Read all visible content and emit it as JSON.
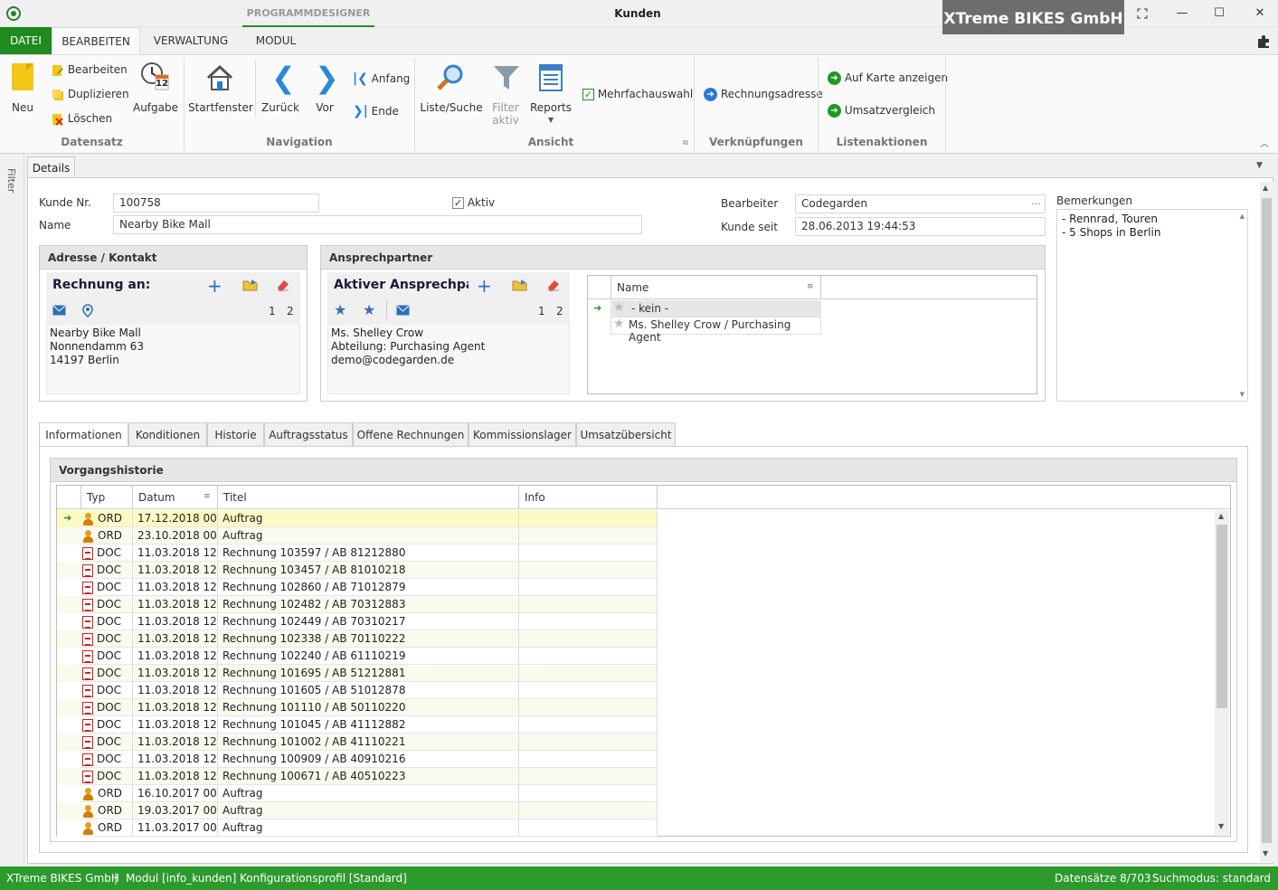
{
  "titlebar": {
    "context_title": "PROGRAMMDESIGNER",
    "window_title": "Kunden",
    "brand": "XTreme BIKES GmbH",
    "controls": {
      "restore_icon": "restore-icon",
      "minimize": "—",
      "maximize": "☐",
      "close": "✕"
    }
  },
  "menu": {
    "tabs": [
      {
        "label": "DATEI"
      },
      {
        "label": "BEARBEITEN"
      },
      {
        "label": "VERWALTUNG"
      },
      {
        "label": "MODUL"
      }
    ]
  },
  "ribbon": {
    "datensatz": {
      "label": "Datensatz",
      "new": "Neu",
      "edit": "Bearbeiten",
      "duplicate": "Duplizieren",
      "delete": "Löschen",
      "task": "Aufgabe",
      "task_badge": "12"
    },
    "navigation": {
      "label": "Navigation",
      "home": "Startfenster",
      "back": "Zurück",
      "forward": "Vor",
      "first": "Anfang",
      "last": "Ende"
    },
    "ansicht": {
      "label": "Ansicht",
      "search": "Liste/Suche",
      "filter": "Filter aktiv",
      "reports": "Reports",
      "multi": "Mehrfachauswahl"
    },
    "verknuepfungen": {
      "label": "Verknüpfungen",
      "invoice_address": "Rechnungsadresse"
    },
    "listenaktionen": {
      "label": "Listenaktionen",
      "map": "Auf Karte anzeigen",
      "compare": "Umsatzvergleich"
    }
  },
  "sidebar": {
    "filter": "Filter"
  },
  "detail_tab": "Details",
  "form": {
    "customer_no_label": "Kunde Nr.",
    "customer_no": "100758",
    "name_label": "Name",
    "name": "Nearby Bike Mall",
    "active_label": "Aktiv",
    "editor_label": "Bearbeiter",
    "editor": "Codegarden",
    "editor_btn": "...",
    "since_label": "Kunde seit",
    "since": "28.06.2013 19:44:53",
    "remarks_label": "Bemerkungen",
    "remarks": [
      "- Rennrad, Touren",
      "- 5 Shops in Berlin"
    ]
  },
  "address": {
    "header": "Adresse / Kontakt",
    "card_title": "Rechnung an:",
    "pages": [
      "1",
      "2"
    ],
    "lines": [
      "Nearby Bike Mall",
      "Nonnendamm 63",
      "14197 Berlin"
    ]
  },
  "contact": {
    "header": "Ansprechpartner",
    "card_title": "Aktiver Ansprechpart",
    "pages": [
      "1",
      "2"
    ],
    "lines": [
      "Ms. Shelley Crow",
      "Abteilung: Purchasing Agent",
      "demo@codegarden.de"
    ],
    "grid_header": "Name",
    "rows": [
      "- kein -",
      "Ms. Shelley Crow / Purchasing Agent"
    ]
  },
  "subtabs": [
    "Informationen",
    "Konditionen",
    "Historie",
    "Auftragsstatus",
    "Offene Rechnungen",
    "Kommissionslager",
    "Umsatzübersicht"
  ],
  "history": {
    "header": "Vorgangshistorie",
    "columns": [
      "Typ",
      "Datum",
      "Titel",
      "Info"
    ],
    "rows": [
      {
        "typ": "ORD",
        "datum": "17.12.2018 00:...",
        "titel": "Auftrag"
      },
      {
        "typ": "ORD",
        "datum": "23.10.2018 00:...",
        "titel": "Auftrag"
      },
      {
        "typ": "DOC",
        "datum": "11.03.2018 12:...",
        "titel": "Rechnung 103597 / AB 81212880"
      },
      {
        "typ": "DOC",
        "datum": "11.03.2018 12:...",
        "titel": "Rechnung 103457 / AB 81010218"
      },
      {
        "typ": "DOC",
        "datum": "11.03.2018 12:...",
        "titel": "Rechnung 102860 / AB 71012879"
      },
      {
        "typ": "DOC",
        "datum": "11.03.2018 12:...",
        "titel": "Rechnung 102482 / AB 70312883"
      },
      {
        "typ": "DOC",
        "datum": "11.03.2018 12:...",
        "titel": "Rechnung 102449 / AB 70310217"
      },
      {
        "typ": "DOC",
        "datum": "11.03.2018 12:...",
        "titel": "Rechnung 102338 / AB 70110222"
      },
      {
        "typ": "DOC",
        "datum": "11.03.2018 12:...",
        "titel": "Rechnung 102240 / AB 61110219"
      },
      {
        "typ": "DOC",
        "datum": "11.03.2018 12:...",
        "titel": "Rechnung 101695 / AB 51212881"
      },
      {
        "typ": "DOC",
        "datum": "11.03.2018 12:...",
        "titel": "Rechnung 101605 / AB 51012878"
      },
      {
        "typ": "DOC",
        "datum": "11.03.2018 12:...",
        "titel": "Rechnung 101110 / AB 50110220"
      },
      {
        "typ": "DOC",
        "datum": "11.03.2018 12:...",
        "titel": "Rechnung 101045 / AB 41112882"
      },
      {
        "typ": "DOC",
        "datum": "11.03.2018 12:...",
        "titel": "Rechnung 101002 / AB 41110221"
      },
      {
        "typ": "DOC",
        "datum": "11.03.2018 12:...",
        "titel": "Rechnung 100909 / AB 40910216"
      },
      {
        "typ": "DOC",
        "datum": "11.03.2018 12:...",
        "titel": "Rechnung 100671 / AB 40510223"
      },
      {
        "typ": "ORD",
        "datum": "16.10.2017 00:...",
        "titel": "Auftrag"
      },
      {
        "typ": "ORD",
        "datum": "19.03.2017 00:...",
        "titel": "Auftrag"
      },
      {
        "typ": "ORD",
        "datum": "11.03.2017 00:...",
        "titel": "Auftrag"
      }
    ]
  },
  "status": {
    "company": "XTreme BIKES GmbH",
    "sep": "|",
    "module": "Modul [info_kunden]",
    "profile": "Konfigurationsprofil [Standard]",
    "records": "Datensätze 8/703",
    "search_mode": "Suchmodus: standard"
  },
  "colors": {
    "accent": "#1f8a1f",
    "status": "#2d9a2d",
    "brand_bg": "#6d6d6d",
    "selected_row": "#fdf9c4"
  }
}
